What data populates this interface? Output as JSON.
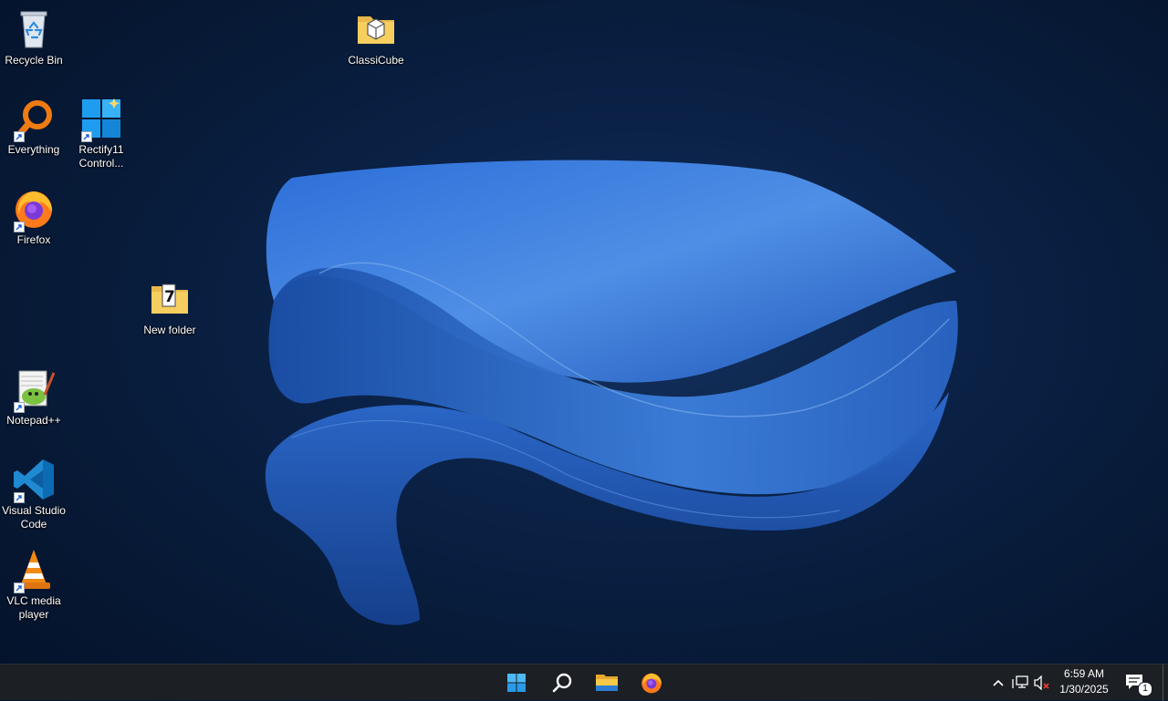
{
  "desktop": {
    "icons": [
      {
        "label": "Recycle Bin"
      },
      {
        "label": "ClassiCube"
      },
      {
        "label": "Everything"
      },
      {
        "label": "Rectify11 Control..."
      },
      {
        "label": "Firefox"
      },
      {
        "label": "New folder"
      },
      {
        "label": "Notepad++"
      },
      {
        "label": "Visual Studio Code"
      },
      {
        "label": "VLC media player"
      }
    ]
  },
  "taskbar": {
    "pinned": [
      {
        "icon": "windows-start-icon"
      },
      {
        "icon": "search-icon"
      },
      {
        "icon": "file-explorer-icon"
      },
      {
        "icon": "firefox-icon"
      }
    ],
    "tray": {
      "time": "6:59 AM",
      "date": "1/30/2025",
      "notification_count": "1",
      "volume_state": "muted"
    }
  },
  "colors": {
    "taskbar_bg": "#1c1f24",
    "wallpaper_accent": "#3a7bd5"
  }
}
